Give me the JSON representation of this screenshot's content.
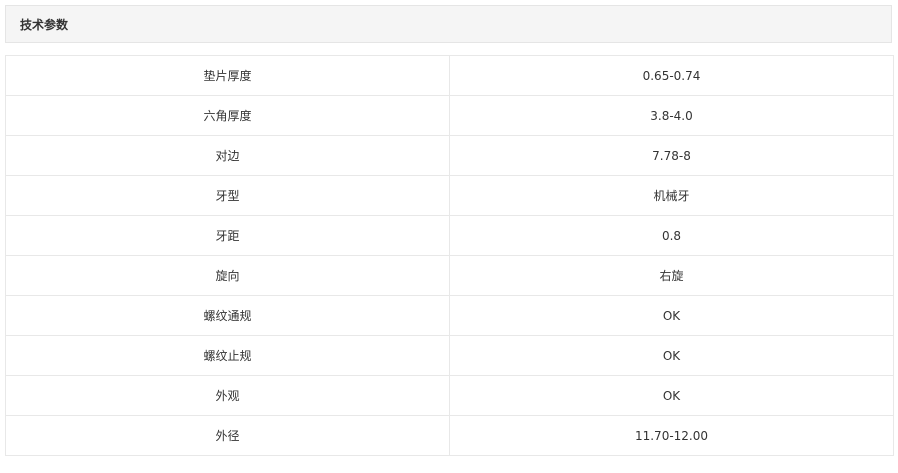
{
  "section": {
    "title": "技术参数"
  },
  "specs": [
    {
      "name": "垫片厚度",
      "value": "0.65-0.74"
    },
    {
      "name": "六角厚度",
      "value": "3.8-4.0"
    },
    {
      "name": "对边",
      "value": "7.78-8"
    },
    {
      "name": "牙型",
      "value": "机械牙"
    },
    {
      "name": "牙距",
      "value": "0.8"
    },
    {
      "name": "旋向",
      "value": "右旋"
    },
    {
      "name": "螺纹通规",
      "value": "OK"
    },
    {
      "name": "螺纹止规",
      "value": "OK"
    },
    {
      "name": "外观",
      "value": "OK"
    },
    {
      "name": "外径",
      "value": "11.70-12.00"
    }
  ]
}
